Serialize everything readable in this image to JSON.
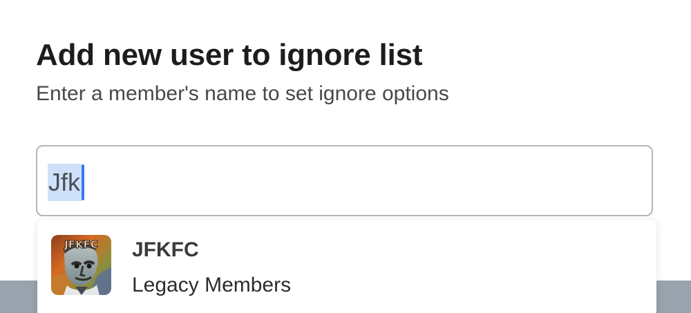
{
  "dialog": {
    "title": "Add new user to ignore list",
    "subtitle": "Enter a member's name to set ignore options"
  },
  "search": {
    "value": "Jfk"
  },
  "results": [
    {
      "name": "JFKFC",
      "group": "Legacy Members",
      "avatar_text": "JFKFC",
      "avatar_icon": "portrait-avatar"
    }
  ],
  "colors": {
    "selection": "#cfe1fa",
    "caret": "#3478f6",
    "border": "#b4b4b8",
    "backdrop": "#98a3ad"
  }
}
